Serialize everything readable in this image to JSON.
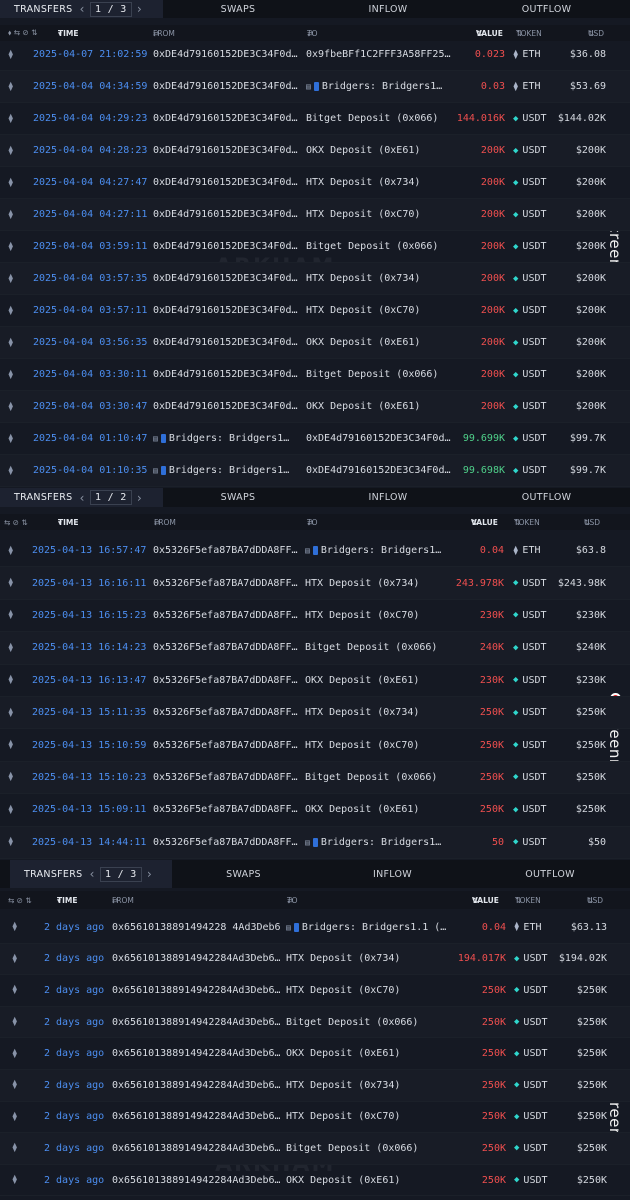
{
  "tabs": {
    "transfers": "TRANSFERS",
    "swaps": "SWAPS",
    "inflow": "INFLOW",
    "outflow": "OUTFLOW"
  },
  "columns": {
    "time": "TIME",
    "from": "FROM",
    "to": "TO",
    "value": "VALUE",
    "token": "TOKEN",
    "usd": "USD"
  },
  "watermark": "ARKHAM",
  "screenrec": "screenrec",
  "panels": [
    {
      "page": "1",
      "pages": "3",
      "rows": [
        {
          "time": "2025-04-07 21:02:59",
          "from": "0xDE4d79160152DE3C34F0d…",
          "to": "0x9fbeBFf1C2FFF3A58FF25…",
          "to_icon": "",
          "value": "0.023",
          "dir": "out",
          "token": "ETH",
          "usd": "$36.08"
        },
        {
          "time": "2025-04-04 04:34:59",
          "from": "0xDE4d79160152DE3C34F0d…",
          "to": "Bridgers: Bridgers1…",
          "to_icon": "doc",
          "value": "0.03",
          "dir": "out",
          "token": "ETH",
          "usd": "$53.69"
        },
        {
          "time": "2025-04-04 04:29:23",
          "from": "0xDE4d79160152DE3C34F0d…",
          "to": "Bitget Deposit (0x066)",
          "to_icon": "",
          "value": "144.016K",
          "dir": "out",
          "token": "USDT",
          "usd": "$144.02K"
        },
        {
          "time": "2025-04-04 04:28:23",
          "from": "0xDE4d79160152DE3C34F0d…",
          "to": "OKX Deposit (0xE61)",
          "to_icon": "",
          "value": "200K",
          "dir": "out",
          "token": "USDT",
          "usd": "$200K"
        },
        {
          "time": "2025-04-04 04:27:47",
          "from": "0xDE4d79160152DE3C34F0d…",
          "to": "HTX Deposit (0x734)",
          "to_icon": "",
          "value": "200K",
          "dir": "out",
          "token": "USDT",
          "usd": "$200K"
        },
        {
          "time": "2025-04-04 04:27:11",
          "from": "0xDE4d79160152DE3C34F0d…",
          "to": "HTX Deposit (0xC70)",
          "to_icon": "",
          "value": "200K",
          "dir": "out",
          "token": "USDT",
          "usd": "$200K"
        },
        {
          "time": "2025-04-04 03:59:11",
          "from": "0xDE4d79160152DE3C34F0d…",
          "to": "Bitget Deposit (0x066)",
          "to_icon": "",
          "value": "200K",
          "dir": "out",
          "token": "USDT",
          "usd": "$200K"
        },
        {
          "time": "2025-04-04 03:57:35",
          "from": "0xDE4d79160152DE3C34F0d…",
          "to": "HTX Deposit (0x734)",
          "to_icon": "",
          "value": "200K",
          "dir": "out",
          "token": "USDT",
          "usd": "$200K"
        },
        {
          "time": "2025-04-04 03:57:11",
          "from": "0xDE4d79160152DE3C34F0d…",
          "to": "HTX Deposit (0xC70)",
          "to_icon": "",
          "value": "200K",
          "dir": "out",
          "token": "USDT",
          "usd": "$200K"
        },
        {
          "time": "2025-04-04 03:56:35",
          "from": "0xDE4d79160152DE3C34F0d…",
          "to": "OKX Deposit (0xE61)",
          "to_icon": "",
          "value": "200K",
          "dir": "out",
          "token": "USDT",
          "usd": "$200K"
        },
        {
          "time": "2025-04-04 03:30:11",
          "from": "0xDE4d79160152DE3C34F0d…",
          "to": "Bitget Deposit (0x066)",
          "to_icon": "",
          "value": "200K",
          "dir": "out",
          "token": "USDT",
          "usd": "$200K"
        },
        {
          "time": "2025-04-04 03:30:47",
          "from": "0xDE4d79160152DE3C34F0d…",
          "to": "OKX Deposit (0xE61)",
          "to_icon": "",
          "value": "200K",
          "dir": "out",
          "token": "USDT",
          "usd": "$200K"
        },
        {
          "time": "2025-04-04 01:10:47",
          "from": "Bridgers: Bridgers1…",
          "from_icon": "doc",
          "to": "0xDE4d79160152DE3C34F0d…",
          "to_icon": "",
          "value": "99.699K",
          "dir": "in",
          "token": "USDT",
          "usd": "$99.7K"
        },
        {
          "time": "2025-04-04 01:10:35",
          "from": "Bridgers: Bridgers1…",
          "from_icon": "doc",
          "to": "0xDE4d79160152DE3C34F0d…",
          "to_icon": "",
          "value": "99.698K",
          "dir": "in",
          "token": "USDT",
          "usd": "$99.7K"
        }
      ]
    },
    {
      "page": "1",
      "pages": "2",
      "rows": [
        {
          "time": "2025-04-13 16:57:47",
          "from": "0x5326F5efa87BA7dDDA8FF…",
          "to": "Bridgers: Bridgers1…",
          "to_icon": "doc",
          "value": "0.04",
          "dir": "out",
          "token": "ETH",
          "usd": "$63.8"
        },
        {
          "time": "2025-04-13 16:16:11",
          "from": "0x5326F5efa87BA7dDDA8FF…",
          "to": "HTX Deposit (0x734)",
          "to_icon": "",
          "value": "243.978K",
          "dir": "out",
          "token": "USDT",
          "usd": "$243.98K"
        },
        {
          "time": "2025-04-13 16:15:23",
          "from": "0x5326F5efa87BA7dDDA8FF…",
          "to": "HTX Deposit (0xC70)",
          "to_icon": "",
          "value": "230K",
          "dir": "out",
          "token": "USDT",
          "usd": "$230K"
        },
        {
          "time": "2025-04-13 16:14:23",
          "from": "0x5326F5efa87BA7dDDA8FF…",
          "to": "Bitget Deposit (0x066)",
          "to_icon": "",
          "value": "240K",
          "dir": "out",
          "token": "USDT",
          "usd": "$240K"
        },
        {
          "time": "2025-04-13 16:13:47",
          "from": "0x5326F5efa87BA7dDDA8FF…",
          "to": "OKX Deposit (0xE61)",
          "to_icon": "",
          "value": "230K",
          "dir": "out",
          "token": "USDT",
          "usd": "$230K"
        },
        {
          "time": "2025-04-13 15:11:35",
          "from": "0x5326F5efa87BA7dDDA8FF…",
          "to": "HTX Deposit (0x734)",
          "to_icon": "",
          "value": "250K",
          "dir": "out",
          "token": "USDT",
          "usd": "$250K"
        },
        {
          "time": "2025-04-13 15:10:59",
          "from": "0x5326F5efa87BA7dDDA8FF…",
          "to": "HTX Deposit (0xC70)",
          "to_icon": "",
          "value": "250K",
          "dir": "out",
          "token": "USDT",
          "usd": "$250K"
        },
        {
          "time": "2025-04-13 15:10:23",
          "from": "0x5326F5efa87BA7dDDA8FF…",
          "to": "Bitget Deposit (0x066)",
          "to_icon": "",
          "value": "250K",
          "dir": "out",
          "token": "USDT",
          "usd": "$250K"
        },
        {
          "time": "2025-04-13 15:09:11",
          "from": "0x5326F5efa87BA7dDDA8FF…",
          "to": "OKX Deposit (0xE61)",
          "to_icon": "",
          "value": "250K",
          "dir": "out",
          "token": "USDT",
          "usd": "$250K"
        },
        {
          "time": "2025-04-13 14:44:11",
          "from": "0x5326F5efa87BA7dDDA8FF…",
          "to": "Bridgers: Bridgers1…",
          "to_icon": "doc",
          "value": "50",
          "dir": "out",
          "token": "USDT",
          "usd": "$50"
        }
      ]
    },
    {
      "page": "1",
      "pages": "3",
      "rows": [
        {
          "time": "2 days ago",
          "from": "0x65610138891494228 4Ad3Deb6…",
          "to": "Bridgers: Bridgers1.1 (…",
          "to_icon": "doc",
          "value": "0.04",
          "dir": "out",
          "token": "ETH",
          "usd": "$63.13"
        },
        {
          "time": "2 days ago",
          "from": "0x656101388914942284Ad3Deb6…",
          "to": "HTX Deposit (0x734)",
          "to_icon": "",
          "value": "194.017K",
          "dir": "out",
          "token": "USDT",
          "usd": "$194.02K"
        },
        {
          "time": "2 days ago",
          "from": "0x656101388914942284Ad3Deb6…",
          "to": "HTX Deposit (0xC70)",
          "to_icon": "",
          "value": "250K",
          "dir": "out",
          "token": "USDT",
          "usd": "$250K"
        },
        {
          "time": "2 days ago",
          "from": "0x656101388914942284Ad3Deb6…",
          "to": "Bitget Deposit (0x066)",
          "to_icon": "",
          "value": "250K",
          "dir": "out",
          "token": "USDT",
          "usd": "$250K"
        },
        {
          "time": "2 days ago",
          "from": "0x656101388914942284Ad3Deb6…",
          "to": "OKX Deposit (0xE61)",
          "to_icon": "",
          "value": "250K",
          "dir": "out",
          "token": "USDT",
          "usd": "$250K"
        },
        {
          "time": "2 days ago",
          "from": "0x656101388914942284Ad3Deb6…",
          "to": "HTX Deposit (0x734)",
          "to_icon": "",
          "value": "250K",
          "dir": "out",
          "token": "USDT",
          "usd": "$250K"
        },
        {
          "time": "2 days ago",
          "from": "0x656101388914942284Ad3Deb6…",
          "to": "HTX Deposit (0xC70)",
          "to_icon": "",
          "value": "250K",
          "dir": "out",
          "token": "USDT",
          "usd": "$250K"
        },
        {
          "time": "2 days ago",
          "from": "0x656101388914942284Ad3Deb6…",
          "to": "Bitget Deposit (0x066)",
          "to_icon": "",
          "value": "250K",
          "dir": "out",
          "token": "USDT",
          "usd": "$250K"
        },
        {
          "time": "2 days ago",
          "from": "0x656101388914942284Ad3Deb6…",
          "to": "OKX Deposit (0xE61)",
          "to_icon": "",
          "value": "250K",
          "dir": "out",
          "token": "USDT",
          "usd": "$250K"
        }
      ]
    }
  ]
}
